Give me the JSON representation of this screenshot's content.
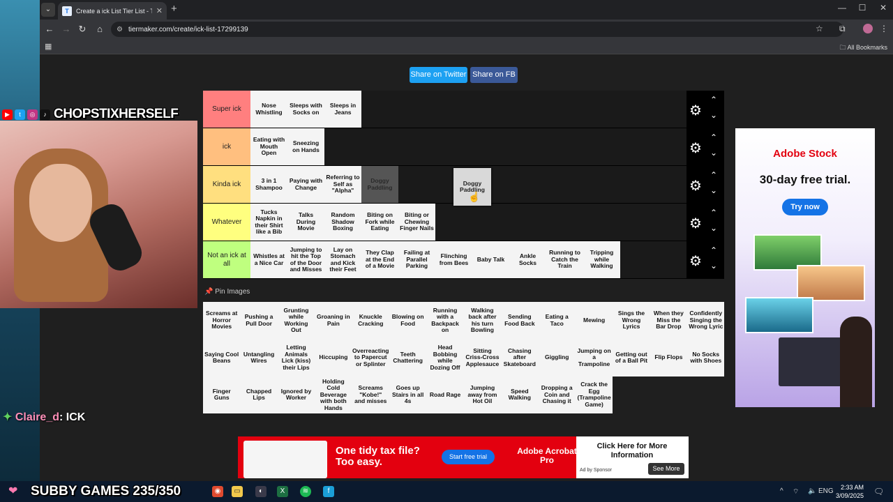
{
  "browser": {
    "tab_title": "Create a ick List Tier List - TierMaker",
    "url": "tiermaker.com/create/ick-list-17299139",
    "bookmarks_label": "All Bookmarks"
  },
  "share": {
    "twitter": "Share on Twitter",
    "facebook": "Share on FB"
  },
  "tiers": [
    {
      "label": "Super ick",
      "color": "#ff7f7f",
      "items": [
        "Nose Whistling",
        "Sleeps with Socks on",
        "Sleeps in Jeans"
      ]
    },
    {
      "label": "ick",
      "color": "#ffbf7f",
      "items": [
        "Eating with Mouth Open",
        "Sneezing on Hands"
      ]
    },
    {
      "label": "Kinda ick",
      "color": "#ffdf7f",
      "items": [
        "3 in 1 Shampoo",
        "Paying with Change",
        "Referring to Self as \"Alpha\""
      ],
      "ghost": "Doggy Paddling"
    },
    {
      "label": "Whatever",
      "color": "#ffff7f",
      "items": [
        "Tucks Napkin in their Shirt like a Bib",
        "Talks During Movie",
        "Random Shadow Boxing",
        "Biting on Fork while Eating",
        "Biting or Chewing Finger Nails"
      ]
    },
    {
      "label": "Not an ick at all",
      "color": "#bfff7f",
      "items": [
        "Whistles at a Nice Car",
        "Jumping to hit the Top of the Door and Misses",
        "Lay on Stomach and Kick their Feet",
        "They Clap at the End of a Movie",
        "Failing at Parallel Parking",
        "Flinching from Bees",
        "Baby Talk",
        "Ankle Socks",
        "Running to Catch the Train",
        "Tripping while Walking"
      ]
    }
  ],
  "dragging": "Doggy Paddling",
  "pin_label": "Pin Images",
  "pool": [
    "Screams at Horror Movies",
    "Pushing a Pull Door",
    "Grunting while Working Out",
    "Groaning in Pain",
    "Knuckle Cracking",
    "Blowing on Food",
    "Running with a Backpack on",
    "Walking back after his turn Bowling",
    "Sending Food Back",
    "Eating a Taco",
    "Mewing",
    "Sings the Wrong Lyrics",
    "When they Miss the Bar Drop",
    "Confidently Singing the Wrong Lyric",
    "Saying Cool Beans",
    "Untangling Wires",
    "Letting Animals Lick (kiss) their Lips",
    "Hiccuping",
    "Overreacting to Papercut or Splinter",
    "Teeth Chattering",
    "Head Bobbing while Dozing Off",
    "Sitting Criss-Cross Applesauce",
    "Chasing after Skateboard",
    "Giggling",
    "Jumping on a Trampoline",
    "Getting out of a Ball Pit",
    "Flip Flops",
    "No Socks with Shoes",
    "Finger Guns",
    "Chapped Lips",
    "Ignored by Worker",
    "Holding Cold Beverage with both Hands",
    "Screams \"Kobe!\" and misses",
    "Goes up Stairs in all 4s",
    "Road Rage",
    "Jumping away from Hot Oil",
    "Speed Walking",
    "Dropping a Coin and Chasing it",
    "Crack the Egg (Trampoline Game)"
  ],
  "ad_right": {
    "brand": "Adobe Stock",
    "headline": "30-day free trial.",
    "cta": "Try now"
  },
  "ad_bottom": {
    "headline": "One tidy tax file? Too easy.",
    "cta": "Start free trial",
    "brand": "Adobe Acrobat Pro",
    "click": "Click Here for More Information",
    "sponsor": "Ad by Sponsor",
    "more": "See More"
  },
  "stream": {
    "streamer": "CHOPSTIXHERSELF",
    "chat_user": "Claire_d",
    "chat_msg": ": ICK",
    "subby": "SUBBY GAMES 235/350"
  },
  "taskbar": {
    "lang": "ENG",
    "time": "2:33 AM",
    "date": "3/09/2025"
  }
}
